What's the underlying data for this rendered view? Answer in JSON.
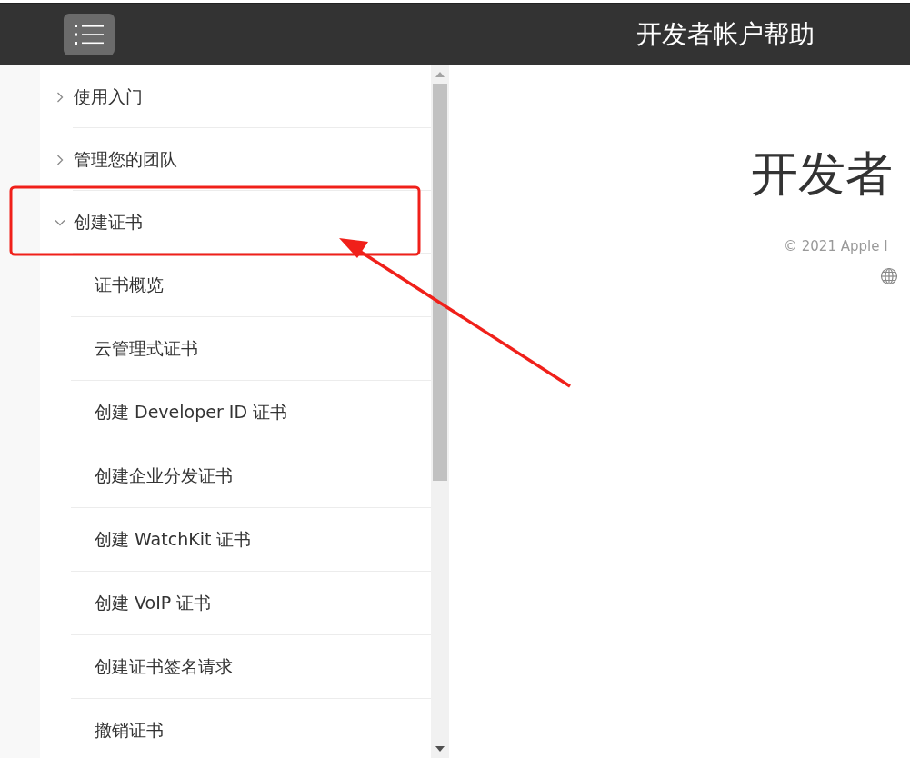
{
  "header": {
    "title": "开发者帐户帮助"
  },
  "sidebar": {
    "items": [
      {
        "label": "使用入门",
        "expanded": false
      },
      {
        "label": "管理您的团队",
        "expanded": false
      },
      {
        "label": "创建证书",
        "expanded": true,
        "children": [
          {
            "label": "证书概览"
          },
          {
            "label": "云管理式证书"
          },
          {
            "label": "创建 Developer ID 证书"
          },
          {
            "label": "创建企业分发证书"
          },
          {
            "label": "创建 WatchKit 证书"
          },
          {
            "label": "创建 VoIP 证书"
          },
          {
            "label": "创建证书签名请求"
          },
          {
            "label": "撤销证书"
          }
        ]
      }
    ]
  },
  "content": {
    "heading": "开发者",
    "copyright": "© 2021 Apple I"
  }
}
